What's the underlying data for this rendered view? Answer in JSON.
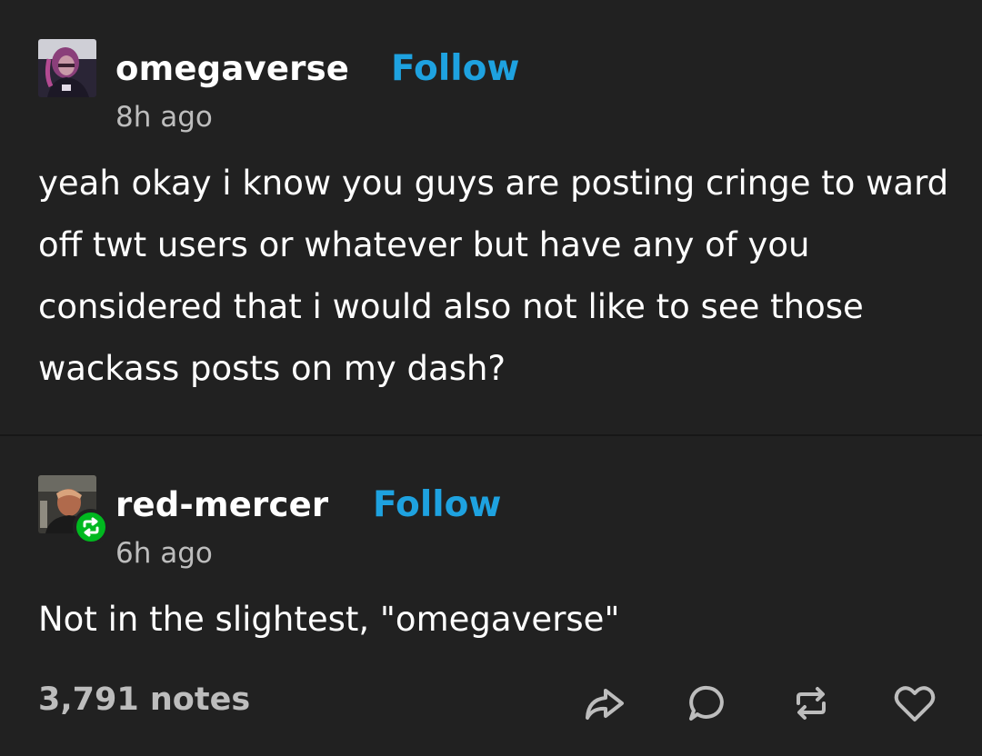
{
  "posts": [
    {
      "username": "omegaverse",
      "follow_label": "Follow",
      "time": "8h ago",
      "body": "yeah okay i know you guys are posting cringe to ward off twt users or whatever but have any of you considered that i would also not like to see those wackass posts on my dash?"
    },
    {
      "username": "red-mercer",
      "follow_label": "Follow",
      "time": "6h ago",
      "body": "Not in the slightest, \"omegaverse\""
    }
  ],
  "footer": {
    "notes": "3,791 notes",
    "actions": [
      "share-icon",
      "reply-icon",
      "reblog-icon",
      "like-icon"
    ]
  },
  "colors": {
    "background": "#212121",
    "follow": "#1ea2e0",
    "meta_text": "#bdbdbd",
    "reblog_badge": "#00b81f"
  }
}
